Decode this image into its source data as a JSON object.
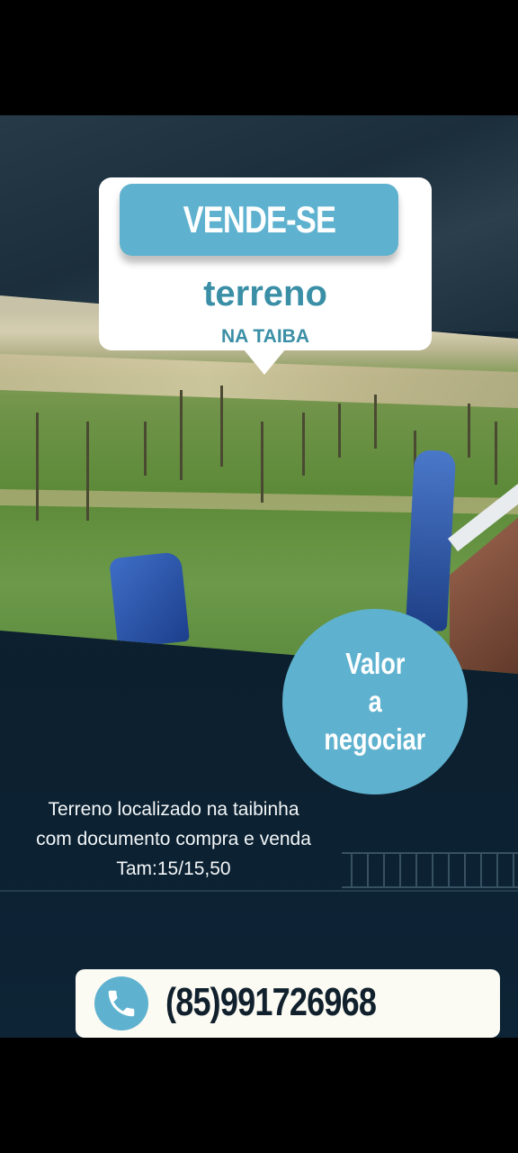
{
  "headline": "VENDE-SE",
  "subtitle": "terreno",
  "location": "NA TAIBA",
  "price_badge": [
    "Valor",
    "a",
    "negociar"
  ],
  "description": [
    "Terreno localizado na taibinha",
    "com documento compra e venda",
    "Tam:15/15,50"
  ],
  "contact": {
    "phone": "(85)991726968",
    "icon": "phone-icon"
  },
  "colors": {
    "accent": "#5fb2cf",
    "title_text": "#3a8fa6",
    "background": "#0f2233"
  }
}
